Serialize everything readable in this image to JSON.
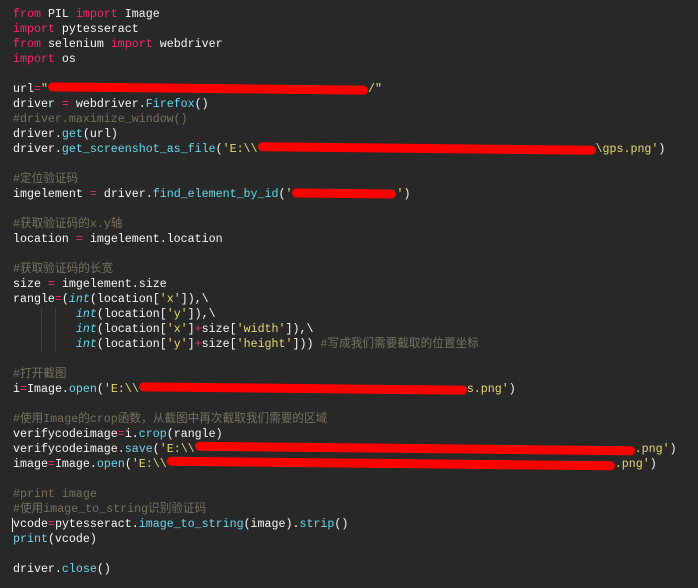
{
  "colors": {
    "background": "#282828",
    "keyword": "#f92672",
    "function": "#66d9ef",
    "string": "#e6db74",
    "comment": "#75715e",
    "text": "#f8f8f2",
    "redaction": "#ff0000"
  },
  "lines": [
    [
      [
        "from",
        "kw"
      ],
      [
        " PIL ",
        "tx"
      ],
      [
        "import",
        "kw"
      ],
      [
        " Image",
        "tx"
      ]
    ],
    [
      [
        "import",
        "kw"
      ],
      [
        " pytesseract",
        "tx"
      ]
    ],
    [
      [
        "from",
        "kw"
      ],
      [
        " selenium ",
        "tx"
      ],
      [
        "import",
        "kw"
      ],
      [
        " webdriver",
        "tx"
      ]
    ],
    [
      [
        "import",
        "kw"
      ],
      [
        " os",
        "tx"
      ]
    ],
    [],
    [
      [
        "url",
        "tx"
      ],
      [
        "=",
        "op"
      ],
      [
        "\"",
        "st"
      ],
      [
        "",
        "redact"
      ],
      [
        "/\"",
        "st"
      ]
    ],
    [
      [
        "driver ",
        "tx"
      ],
      [
        "=",
        "op"
      ],
      [
        " webdriver.",
        "tx"
      ],
      [
        "Firefox",
        "fn"
      ],
      [
        "()",
        "tx"
      ]
    ],
    [
      [
        "#driver.maximize_window()",
        "cm"
      ]
    ],
    [
      [
        "driver.",
        "tx"
      ],
      [
        "get",
        "fn"
      ],
      [
        "(url)",
        "tx"
      ]
    ],
    [
      [
        "driver.",
        "tx"
      ],
      [
        "get_screenshot_as_file",
        "fn"
      ],
      [
        "(",
        "tx"
      ],
      [
        "'E:\\\\",
        "st"
      ],
      [
        "",
        "redact"
      ],
      [
        "\\gps.png'",
        "st"
      ],
      [
        ")",
        "tx"
      ]
    ],
    [],
    [
      [
        "#定位验证码",
        "cm"
      ]
    ],
    [
      [
        "imgelement ",
        "tx"
      ],
      [
        "=",
        "op"
      ],
      [
        " driver.",
        "tx"
      ],
      [
        "find_element_by_id",
        "fn"
      ],
      [
        "(",
        "tx"
      ],
      [
        "'",
        "st"
      ],
      [
        "",
        "redact"
      ],
      [
        "'",
        "st"
      ],
      [
        ")",
        "tx"
      ]
    ],
    [],
    [
      [
        "#获取验证码的x.y轴",
        "cm"
      ]
    ],
    [
      [
        "location ",
        "tx"
      ],
      [
        "=",
        "op"
      ],
      [
        " imgelement.location",
        "tx"
      ]
    ],
    [],
    [
      [
        "#获取验证码的长宽",
        "cm"
      ]
    ],
    [
      [
        "size ",
        "tx"
      ],
      [
        "=",
        "op"
      ],
      [
        " imgelement.size",
        "tx"
      ]
    ],
    [
      [
        "rangle",
        "tx"
      ],
      [
        "=",
        "op"
      ],
      [
        "(",
        "tx"
      ],
      [
        "int",
        "bi"
      ],
      [
        "(location[",
        "tx"
      ],
      [
        "'x'",
        "st"
      ],
      [
        "]),\\",
        "tx"
      ]
    ],
    [
      [
        "         ",
        "tx"
      ],
      [
        "int",
        "bi"
      ],
      [
        "(location[",
        "tx"
      ],
      [
        "'y'",
        "st"
      ],
      [
        "]),\\",
        "tx"
      ]
    ],
    [
      [
        "         ",
        "tx"
      ],
      [
        "int",
        "bi"
      ],
      [
        "(location[",
        "tx"
      ],
      [
        "'x'",
        "st"
      ],
      [
        "]",
        "tx"
      ],
      [
        "+",
        "op"
      ],
      [
        "size[",
        "tx"
      ],
      [
        "'width'",
        "st"
      ],
      [
        "]),\\",
        "tx"
      ]
    ],
    [
      [
        "         ",
        "tx"
      ],
      [
        "int",
        "bi"
      ],
      [
        "(location[",
        "tx"
      ],
      [
        "'y'",
        "st"
      ],
      [
        "]",
        "tx"
      ],
      [
        "+",
        "op"
      ],
      [
        "size[",
        "tx"
      ],
      [
        "'height'",
        "st"
      ],
      [
        "])) ",
        "tx"
      ],
      [
        "#写成我们需要截取的位置坐标",
        "cm"
      ]
    ],
    [],
    [
      [
        "#打开截图",
        "cm"
      ]
    ],
    [
      [
        "i",
        "tx"
      ],
      [
        "=",
        "op"
      ],
      [
        "Image.",
        "tx"
      ],
      [
        "open",
        "fn"
      ],
      [
        "(",
        "tx"
      ],
      [
        "'E:\\\\",
        "st"
      ],
      [
        "",
        "redact"
      ],
      [
        "s.png'",
        "st"
      ],
      [
        ")",
        "tx"
      ]
    ],
    [],
    [
      [
        "#使用Image的crop函数，从截图中再次截取我们需要的区域",
        "cm"
      ]
    ],
    [
      [
        "verifycodeimage",
        "tx"
      ],
      [
        "=",
        "op"
      ],
      [
        "i.",
        "tx"
      ],
      [
        "crop",
        "fn"
      ],
      [
        "(rangle)",
        "tx"
      ]
    ],
    [
      [
        "verifycodeimage.",
        "tx"
      ],
      [
        "save",
        "fn"
      ],
      [
        "(",
        "tx"
      ],
      [
        "'E:\\\\",
        "st"
      ],
      [
        "",
        "redact"
      ],
      [
        ".png'",
        "st"
      ],
      [
        ")",
        "tx"
      ]
    ],
    [
      [
        "image",
        "tx"
      ],
      [
        "=",
        "op"
      ],
      [
        "Image.",
        "tx"
      ],
      [
        "open",
        "fn"
      ],
      [
        "(",
        "tx"
      ],
      [
        "'E:\\\\",
        "st"
      ],
      [
        "",
        "redact"
      ],
      [
        ".png'",
        "st"
      ],
      [
        ")",
        "tx"
      ]
    ],
    [],
    [
      [
        "#print image",
        "cm"
      ]
    ],
    [
      [
        "#使用image_to_string识别验证码",
        "cm"
      ]
    ],
    [
      [
        "vcode",
        "tx"
      ],
      [
        "=",
        "op"
      ],
      [
        "pytesseract.",
        "tx"
      ],
      [
        "image_to_string",
        "fn"
      ],
      [
        "(image).",
        "tx"
      ],
      [
        "strip",
        "fn"
      ],
      [
        "()",
        "tx"
      ]
    ],
    [
      [
        "print",
        "fn"
      ],
      [
        "(vcode)",
        "tx"
      ]
    ],
    [],
    [
      [
        "driver.",
        "tx"
      ],
      [
        "close",
        "fn"
      ],
      [
        "()",
        "tx"
      ]
    ]
  ]
}
